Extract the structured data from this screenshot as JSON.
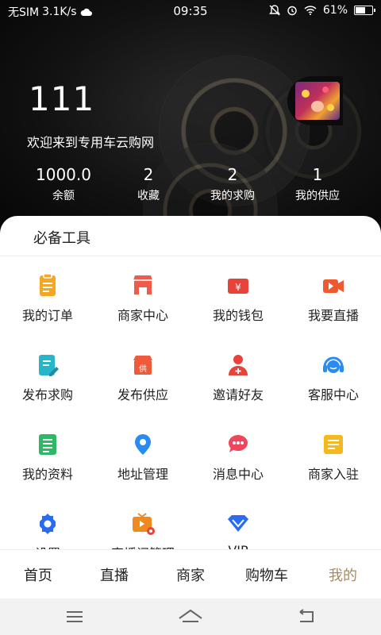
{
  "status_bar": {
    "carrier": "无SIM",
    "speed": "3.1K/s",
    "time": "09:35",
    "battery": "61%",
    "battery_level": 0.61
  },
  "profile": {
    "name": "111",
    "welcome": "欢迎来到专用车云购网"
  },
  "stats": [
    {
      "value": "1000.0",
      "label": "余额"
    },
    {
      "value": "2",
      "label": "收藏"
    },
    {
      "value": "2",
      "label": "我的求购"
    },
    {
      "value": "1",
      "label": "我的供应"
    }
  ],
  "tools": {
    "title": "必备工具",
    "items": [
      {
        "label": "我的订单",
        "icon": "order-icon",
        "color": "#f5a623"
      },
      {
        "label": "商家中心",
        "icon": "store-icon",
        "color": "#f05a4b"
      },
      {
        "label": "我的钱包",
        "icon": "wallet-icon",
        "color": "#e8433a"
      },
      {
        "label": "我要直播",
        "icon": "video-camera-icon",
        "color": "#f0582f"
      },
      {
        "label": "发布求购",
        "icon": "edit-document-icon",
        "color": "#27b6c8"
      },
      {
        "label": "发布供应",
        "icon": "supply-shop-icon",
        "color": "#ef5a3a"
      },
      {
        "label": "邀请好友",
        "icon": "add-user-icon",
        "color": "#e8433a"
      },
      {
        "label": "客服中心",
        "icon": "headset-icon",
        "color": "#2a8bf0"
      },
      {
        "label": "我的资料",
        "icon": "profile-document-icon",
        "color": "#2fb863"
      },
      {
        "label": "地址管理",
        "icon": "location-pin-icon",
        "color": "#2a8bf0"
      },
      {
        "label": "消息中心",
        "icon": "message-bubble-icon",
        "color": "#f0455a"
      },
      {
        "label": "商家入驻",
        "icon": "merchant-register-icon",
        "color": "#f5b820"
      },
      {
        "label": "设置",
        "icon": "settings-gear-icon",
        "color": "#2a6cf0"
      },
      {
        "label": "直播间管理",
        "icon": "live-room-icon",
        "color": "#f08a20"
      },
      {
        "label": "VIP",
        "icon": "vip-diamond-icon",
        "color": "#2a6cf0"
      }
    ]
  },
  "tabbar": {
    "items": [
      "首页",
      "直播",
      "商家",
      "购物车",
      "我的"
    ],
    "active_index": 4,
    "active_color": "#a98a5e"
  }
}
